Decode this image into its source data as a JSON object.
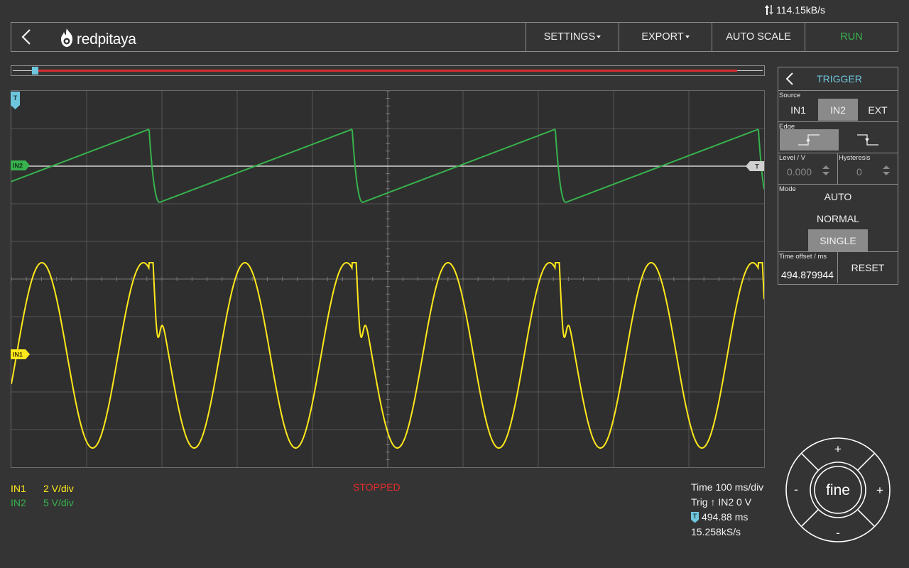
{
  "status": {
    "rate": "114.15kB/s"
  },
  "header": {
    "logo_text": "redpitaya",
    "menu": [
      {
        "label": "SETTINGS",
        "dropdown": true
      },
      {
        "label": "EXPORT",
        "dropdown": true
      },
      {
        "label": "AUTO SCALE",
        "dropdown": false
      },
      {
        "label": "RUN",
        "dropdown": false
      }
    ]
  },
  "plot": {
    "markers": {
      "trigger_top": "T",
      "in2": "IN2",
      "in1": "IN1",
      "trigger_level": "T"
    },
    "grid": {
      "h_divisions": 10,
      "v_divisions": 10
    },
    "colors": {
      "in1": "#ffe81c",
      "in2": "#37b24d",
      "trigger": "#6ec6dc"
    },
    "in2_wave": {
      "shape": "sawtooth",
      "period_ms": 270,
      "min_v": -3.7,
      "max_v": 5.1,
      "axis_offset_div": -1.0
    },
    "in1_wave": {
      "shape": "distorted-sine",
      "axis_offset_div": 2.5
    }
  },
  "channels": [
    {
      "name": "IN1",
      "scale": "2 V/div",
      "color": "#ffe81c"
    },
    {
      "name": "IN2",
      "scale": "5 V/div",
      "color": "#37b24d"
    }
  ],
  "acq_state": "STOPPED",
  "timing": {
    "time": "Time 100 ms/div",
    "trig": "Trig ↑ IN2 0 V",
    "offset_badge": "T",
    "offset": "494.88 ms",
    "sample_rate": "15.258kS/s"
  },
  "trigger_panel": {
    "title": "TRIGGER",
    "source_label": "Source",
    "sources": [
      "IN1",
      "IN2",
      "EXT"
    ],
    "source_active": "IN2",
    "edge_label": "Edge",
    "edge_active": "rising",
    "level_label": "Level / V",
    "level_value": "0.000",
    "hysteresis_label": "Hysteresis",
    "hysteresis_value": "0",
    "mode_label": "Mode",
    "modes": [
      "AUTO",
      "NORMAL",
      "SINGLE"
    ],
    "mode_active": "SINGLE",
    "offset_label": "Time offset / ms",
    "offset_value": "494.879944",
    "reset_label": "RESET"
  },
  "jog": {
    "center": "fine",
    "plus_top": "+",
    "minus_bottom": "-",
    "minus_left": "-",
    "plus_right": "+"
  }
}
